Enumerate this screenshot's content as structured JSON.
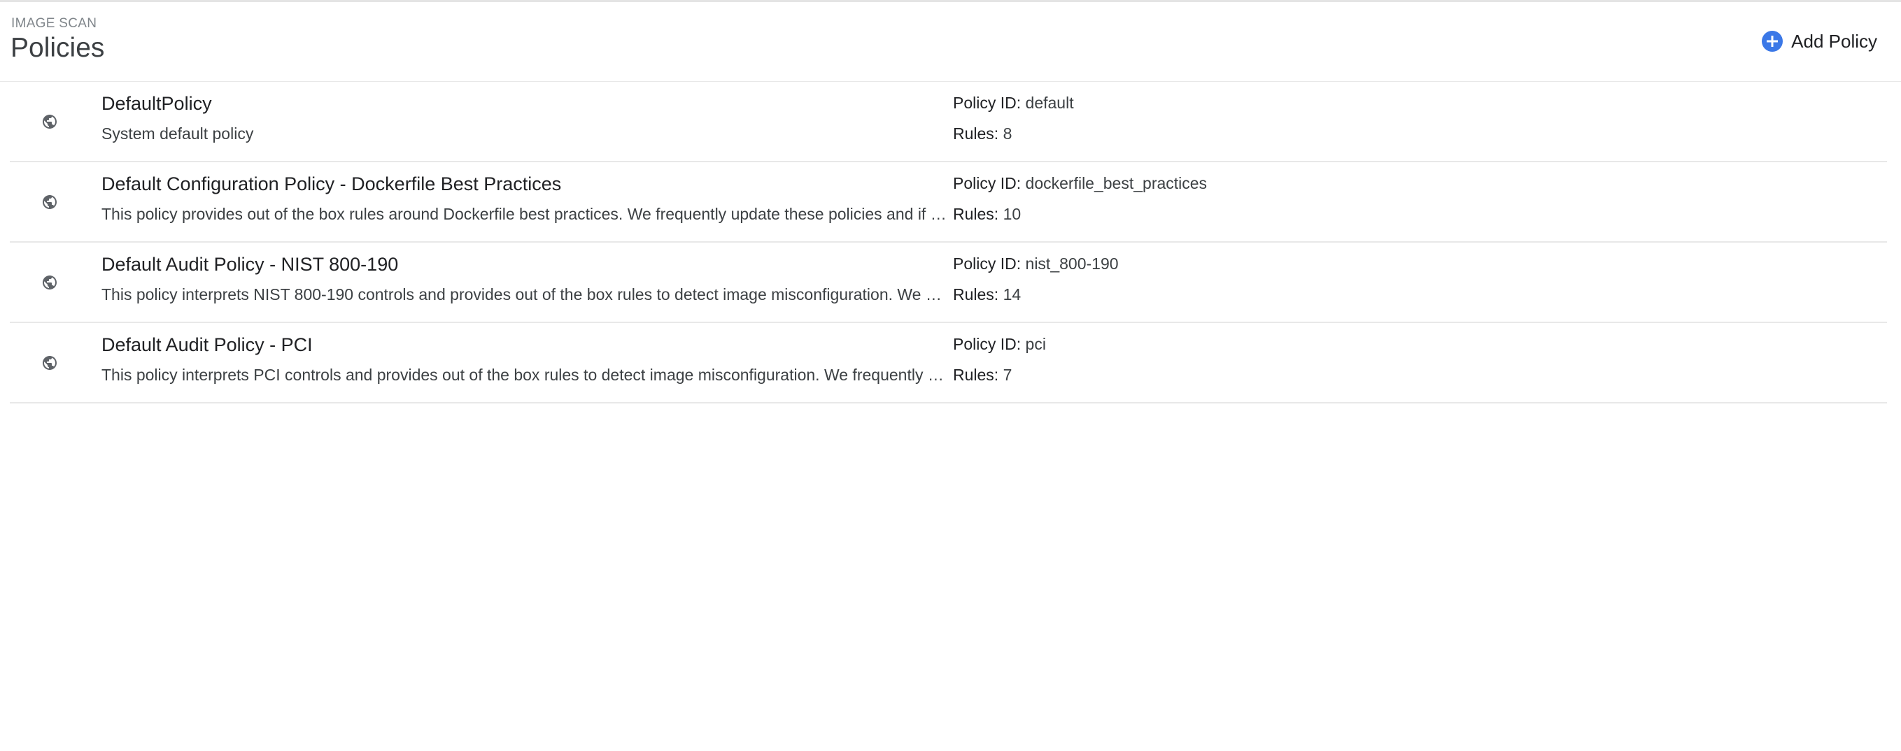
{
  "header": {
    "eyebrow": "IMAGE SCAN",
    "title": "Policies",
    "add_button_label": "Add Policy"
  },
  "labels": {
    "policy_id": "Policy ID:",
    "rules": "Rules:"
  },
  "policies": [
    {
      "name": "DefaultPolicy",
      "description": "System default policy",
      "policy_id": "default",
      "rules": "8",
      "icon": "globe-icon"
    },
    {
      "name": "Default Configuration Policy - Dockerfile Best Practices",
      "description": "This policy provides out of the box rules around Dockerfile best practices. We frequently update these policies and if …",
      "policy_id": "dockerfile_best_practices",
      "rules": "10",
      "icon": "globe-icon"
    },
    {
      "name": "Default Audit Policy - NIST 800-190",
      "description": "This policy interprets NIST 800-190 controls and provides out of the box rules to detect image misconfiguration. We …",
      "policy_id": "nist_800-190",
      "rules": "14",
      "icon": "globe-icon"
    },
    {
      "name": "Default Audit Policy - PCI",
      "description": "This policy interprets PCI controls and provides out of the box rules to detect image misconfiguration. We frequently …",
      "policy_id": "pci",
      "rules": "7",
      "icon": "globe-icon"
    }
  ],
  "colors": {
    "accent": "#3b78e7",
    "divider": "#e8e8e8",
    "icon": "#5f6368"
  }
}
